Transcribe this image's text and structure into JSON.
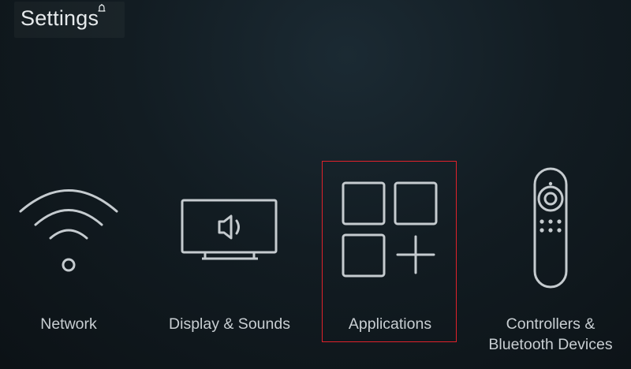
{
  "header": {
    "title": "Settings",
    "notification_icon": "bell-icon"
  },
  "tiles": [
    {
      "label": "Network",
      "icon": "wifi-icon",
      "selected": false
    },
    {
      "label": "Display & Sounds",
      "icon": "display-sound-icon",
      "selected": false
    },
    {
      "label": "Applications",
      "icon": "applications-icon",
      "selected": true
    },
    {
      "label_line1": "Controllers &",
      "label_line2": "Bluetooth Devices",
      "icon": "remote-control-icon",
      "selected": false
    }
  ],
  "colors": {
    "background": "#121c22",
    "focus": "#e0222b",
    "icon_stroke": "#c5cbcf",
    "text": "#c8ced2"
  }
}
